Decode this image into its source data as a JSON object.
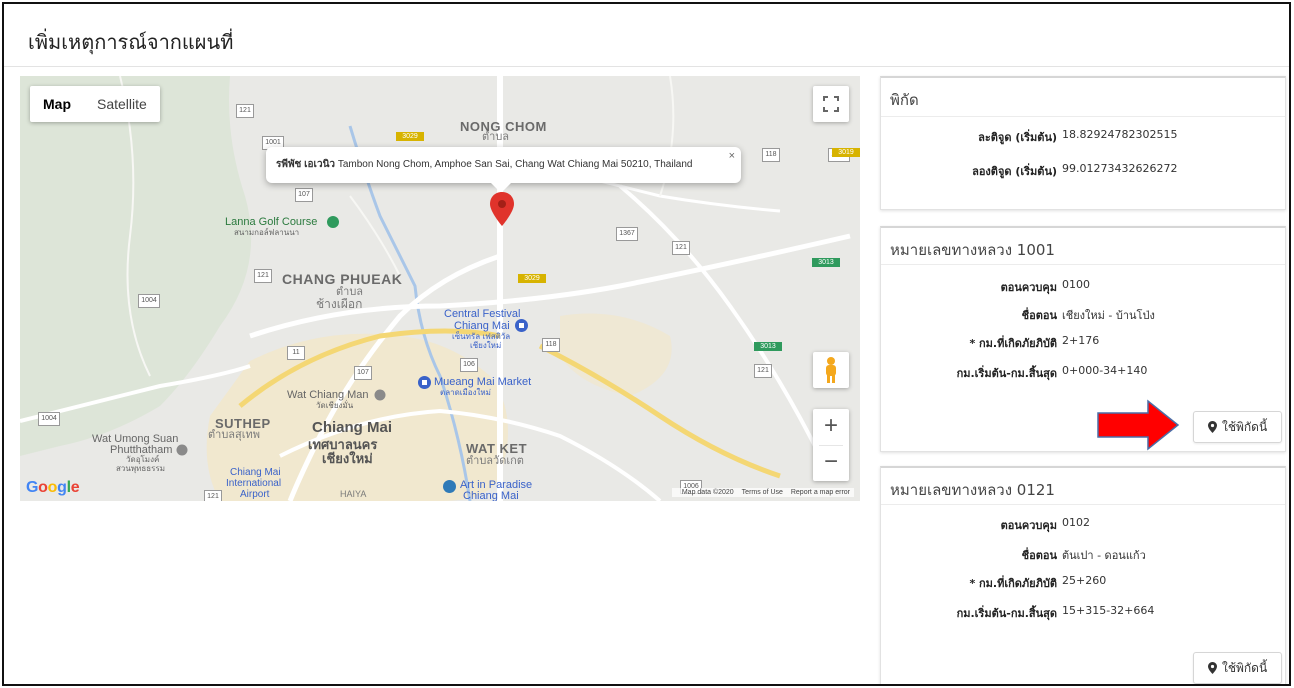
{
  "page": {
    "title": "เพิ่มเหตุการณ์จากแผนที่"
  },
  "map": {
    "type_control": {
      "map_label": "Map",
      "satellite_label": "Satellite",
      "selected": "Map"
    },
    "infowindow": {
      "place_name": "รพีพัช เอเวนิว",
      "address": "Tambon Nong Chom, Amphoe San Sai, Chang Wat Chiang Mai 50210, Thailand",
      "close": "×"
    },
    "labels": {
      "nong_chom": "NONG CHOM",
      "nong_chom_th1": "ตำบล",
      "nong_chom_th2": "หนองจ๊อม",
      "lanna_golf": "Lanna Golf Course",
      "lanna_golf_th": "สนามกอล์ฟลานนา",
      "chang_phueak": "CHANG PHUEAK",
      "chang_phueak_th1": "ตำบล",
      "chang_phueak_th2": "ช้างเผือก",
      "central_festival": "Central Festival",
      "central_festival2": "Chiang Mai",
      "central_festival_th1": "เซ็นทรัล เฟสติวัล",
      "central_festival_th2": "เชียงใหม่",
      "mueang_market": "Mueang Mai Market",
      "mueang_market_th": "ตลาดเมืองใหม่",
      "wat_chiang_man": "Wat Chiang Man",
      "wat_chiang_man_th": "วัดเชียงมั่น",
      "suthep": "SUTHEP",
      "suthep_th": "ตำบลสุเทพ",
      "chiang_mai": "Chiang Mai",
      "chiang_mai_th1": "เทศบาลนคร",
      "chiang_mai_th2": "เชียงใหม่",
      "wat_ket": "WAT KET",
      "wat_ket_th": "ตำบลวัดเกต",
      "wat_umong": "Wat Umong Suan",
      "wat_umong2": "Phutthatham",
      "wat_umong_th1": "วัดอุโมงค์",
      "wat_umong_th2": "สวนพุทธธรรม",
      "airport": "Chiang Mai",
      "airport2": "International",
      "airport3": "Airport",
      "art_paradise": "Art in Paradise",
      "art_paradise2": "Chiang Mai",
      "haiya": "HAIYA"
    },
    "shields": [
      "121",
      "1001",
      "107",
      "1367",
      "121",
      "121",
      "1004",
      "11",
      "107",
      "106",
      "118",
      "118",
      "121",
      "1004",
      "121",
      "1006",
      "1001"
    ],
    "routes": [
      "3029",
      "3029",
      "3013",
      "3013",
      "3019"
    ],
    "google": "Google",
    "attribution": {
      "data": "Map data ©2020",
      "terms": "Terms of Use",
      "report": "Report a map error"
    },
    "zoom": {
      "in": "+",
      "out": "−"
    }
  },
  "coords_card": {
    "title": "พิกัด",
    "rows": [
      {
        "label": "ละติจูด (เริ่มต้น)",
        "value": "18.82924782302515"
      },
      {
        "label": "ลองติจูด (เริ่มต้น)",
        "value": "99.01273432626272"
      }
    ]
  },
  "road_cards": [
    {
      "title": "หมายเลขทางหลวง 1001",
      "rows": [
        {
          "label": "ตอนควบคุม",
          "value": "0100"
        },
        {
          "label": "ชื่อตอน",
          "value": "เชียงใหม่ - บ้านโป่ง"
        },
        {
          "label": "* กม.ที่เกิดภัยภิบัติ",
          "value": "2+176"
        },
        {
          "label": "กม.เริ่มต้น-กม.สิ้นสุด",
          "value": "0+000-34+140"
        }
      ],
      "button": "ใช้พิกัดนี้"
    },
    {
      "title": "หมายเลขทางหลวง 0121",
      "rows": [
        {
          "label": "ตอนควบคุม",
          "value": "0102"
        },
        {
          "label": "ชื่อตอน",
          "value": "ต้นเปา - ดอนแก้ว"
        },
        {
          "label": "* กม.ที่เกิดภัยภิบัติ",
          "value": "25+260"
        },
        {
          "label": "กม.เริ่มต้น-กม.สิ้นสุด",
          "value": "15+315-32+664"
        }
      ],
      "button": "ใช้พิกัดนี้"
    }
  ],
  "colors": {
    "map_bg": "#e9e9e6",
    "mountain": "#dbe3d6",
    "urban": "#f2e6c6",
    "water": "#a9c6e8",
    "marker": "#e0332b",
    "arrow": "#ff0000"
  },
  "icons": [
    "fullscreen-icon",
    "pegman-icon",
    "map-pin-icon",
    "star-pin-icon",
    "red-arrow"
  ]
}
